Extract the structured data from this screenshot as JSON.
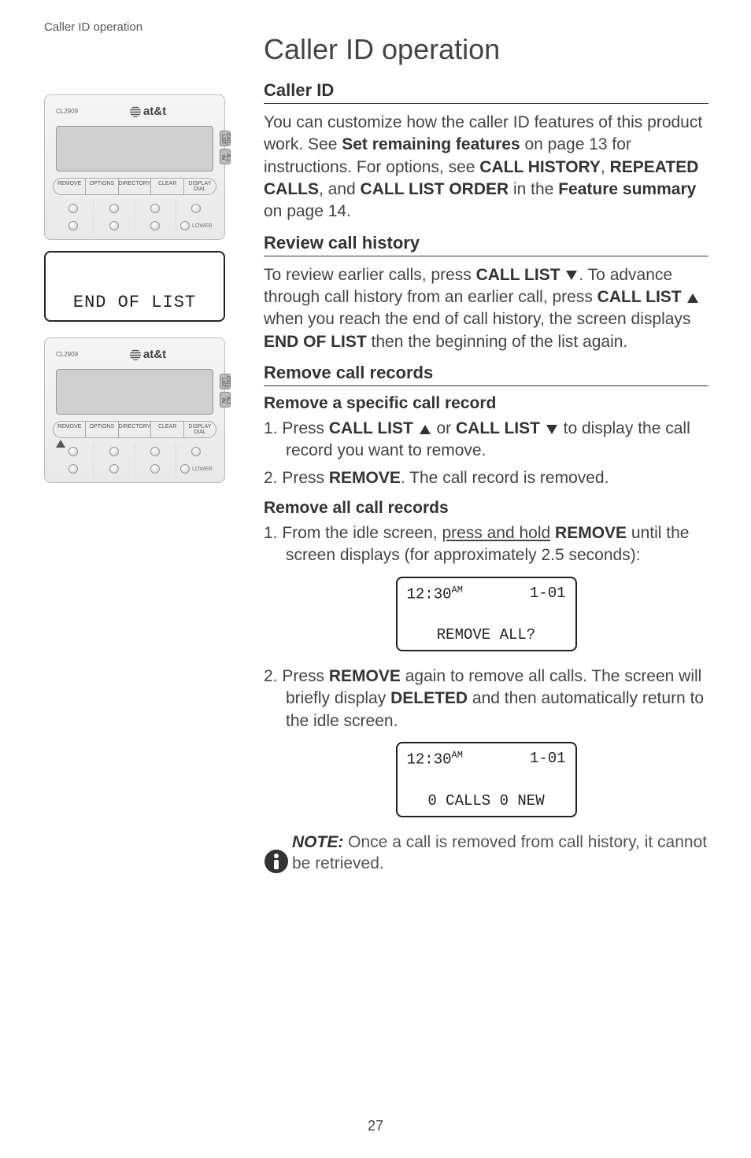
{
  "header": "Caller ID operation",
  "title": "Caller ID operation",
  "phone": {
    "model": "CL2909",
    "brand": "at&t",
    "side_buttons": [
      "CALL LIST",
      "ALL IN"
    ],
    "labels": [
      "REMOVE",
      "OPTIONS",
      "DIRECTORY",
      "CLEAR",
      "DISPLAY DIAL"
    ],
    "lower_label": "LOWER"
  },
  "end_of_list": "END OF LIST",
  "section1": {
    "heading": "Caller ID",
    "text_parts": [
      "You can customize how the caller ID features of this product work. See ",
      "Set remaining features",
      " on page 13 for instructions. For options, see ",
      "CALL HISTORY",
      ", ",
      "REPEATED CALLS",
      ", and ",
      "CALL LIST ORDER",
      " in the ",
      "Feature summary",
      " on page 14."
    ]
  },
  "section2": {
    "heading": "Review call history",
    "text_parts": [
      "To review earlier calls, press ",
      "CALL LIST",
      ". To advance through call history from an earlier call, press ",
      "CALL LIST",
      " when you reach the end of call history, the screen displays ",
      "END OF LIST",
      " then the beginning of the list again."
    ]
  },
  "section3": {
    "heading": "Remove call records",
    "sub1": {
      "heading": "Remove a specific call record",
      "step1_pre": "1. Press ",
      "step1_b1": "CALL LIST",
      "step1_mid": " or ",
      "step1_b2": "CALL LIST",
      "step1_post": " to display the call record you want to remove.",
      "step2_pre": "2. Press ",
      "step2_b": "REMOVE",
      "step2_post": ". The call record is removed."
    },
    "sub2": {
      "heading": "Remove all call records",
      "step1_pre": "1. From the idle screen, ",
      "step1_ul": "press and hold",
      "step1_b": " REMOVE",
      "step1_post": " until the screen displays (for approximately 2.5 seconds):",
      "screen1": {
        "time": "12:30",
        "ampm": "AM",
        "date": "1-01",
        "bottom": "REMOVE ALL?"
      },
      "step2_pre": "2. Press ",
      "step2_b": "REMOVE",
      "step2_mid": " again to remove all calls. The screen will briefly display ",
      "step2_b2": "DELETED",
      "step2_post": " and then automatically return to the idle screen.",
      "screen2": {
        "time": "12:30",
        "ampm": "AM",
        "date": "1-01",
        "bottom": "0 CALLS 0 NEW"
      }
    }
  },
  "note": {
    "label": "NOTE:",
    "text": " Once a call is removed from call history, it cannot be retrieved."
  },
  "page_number": "27"
}
